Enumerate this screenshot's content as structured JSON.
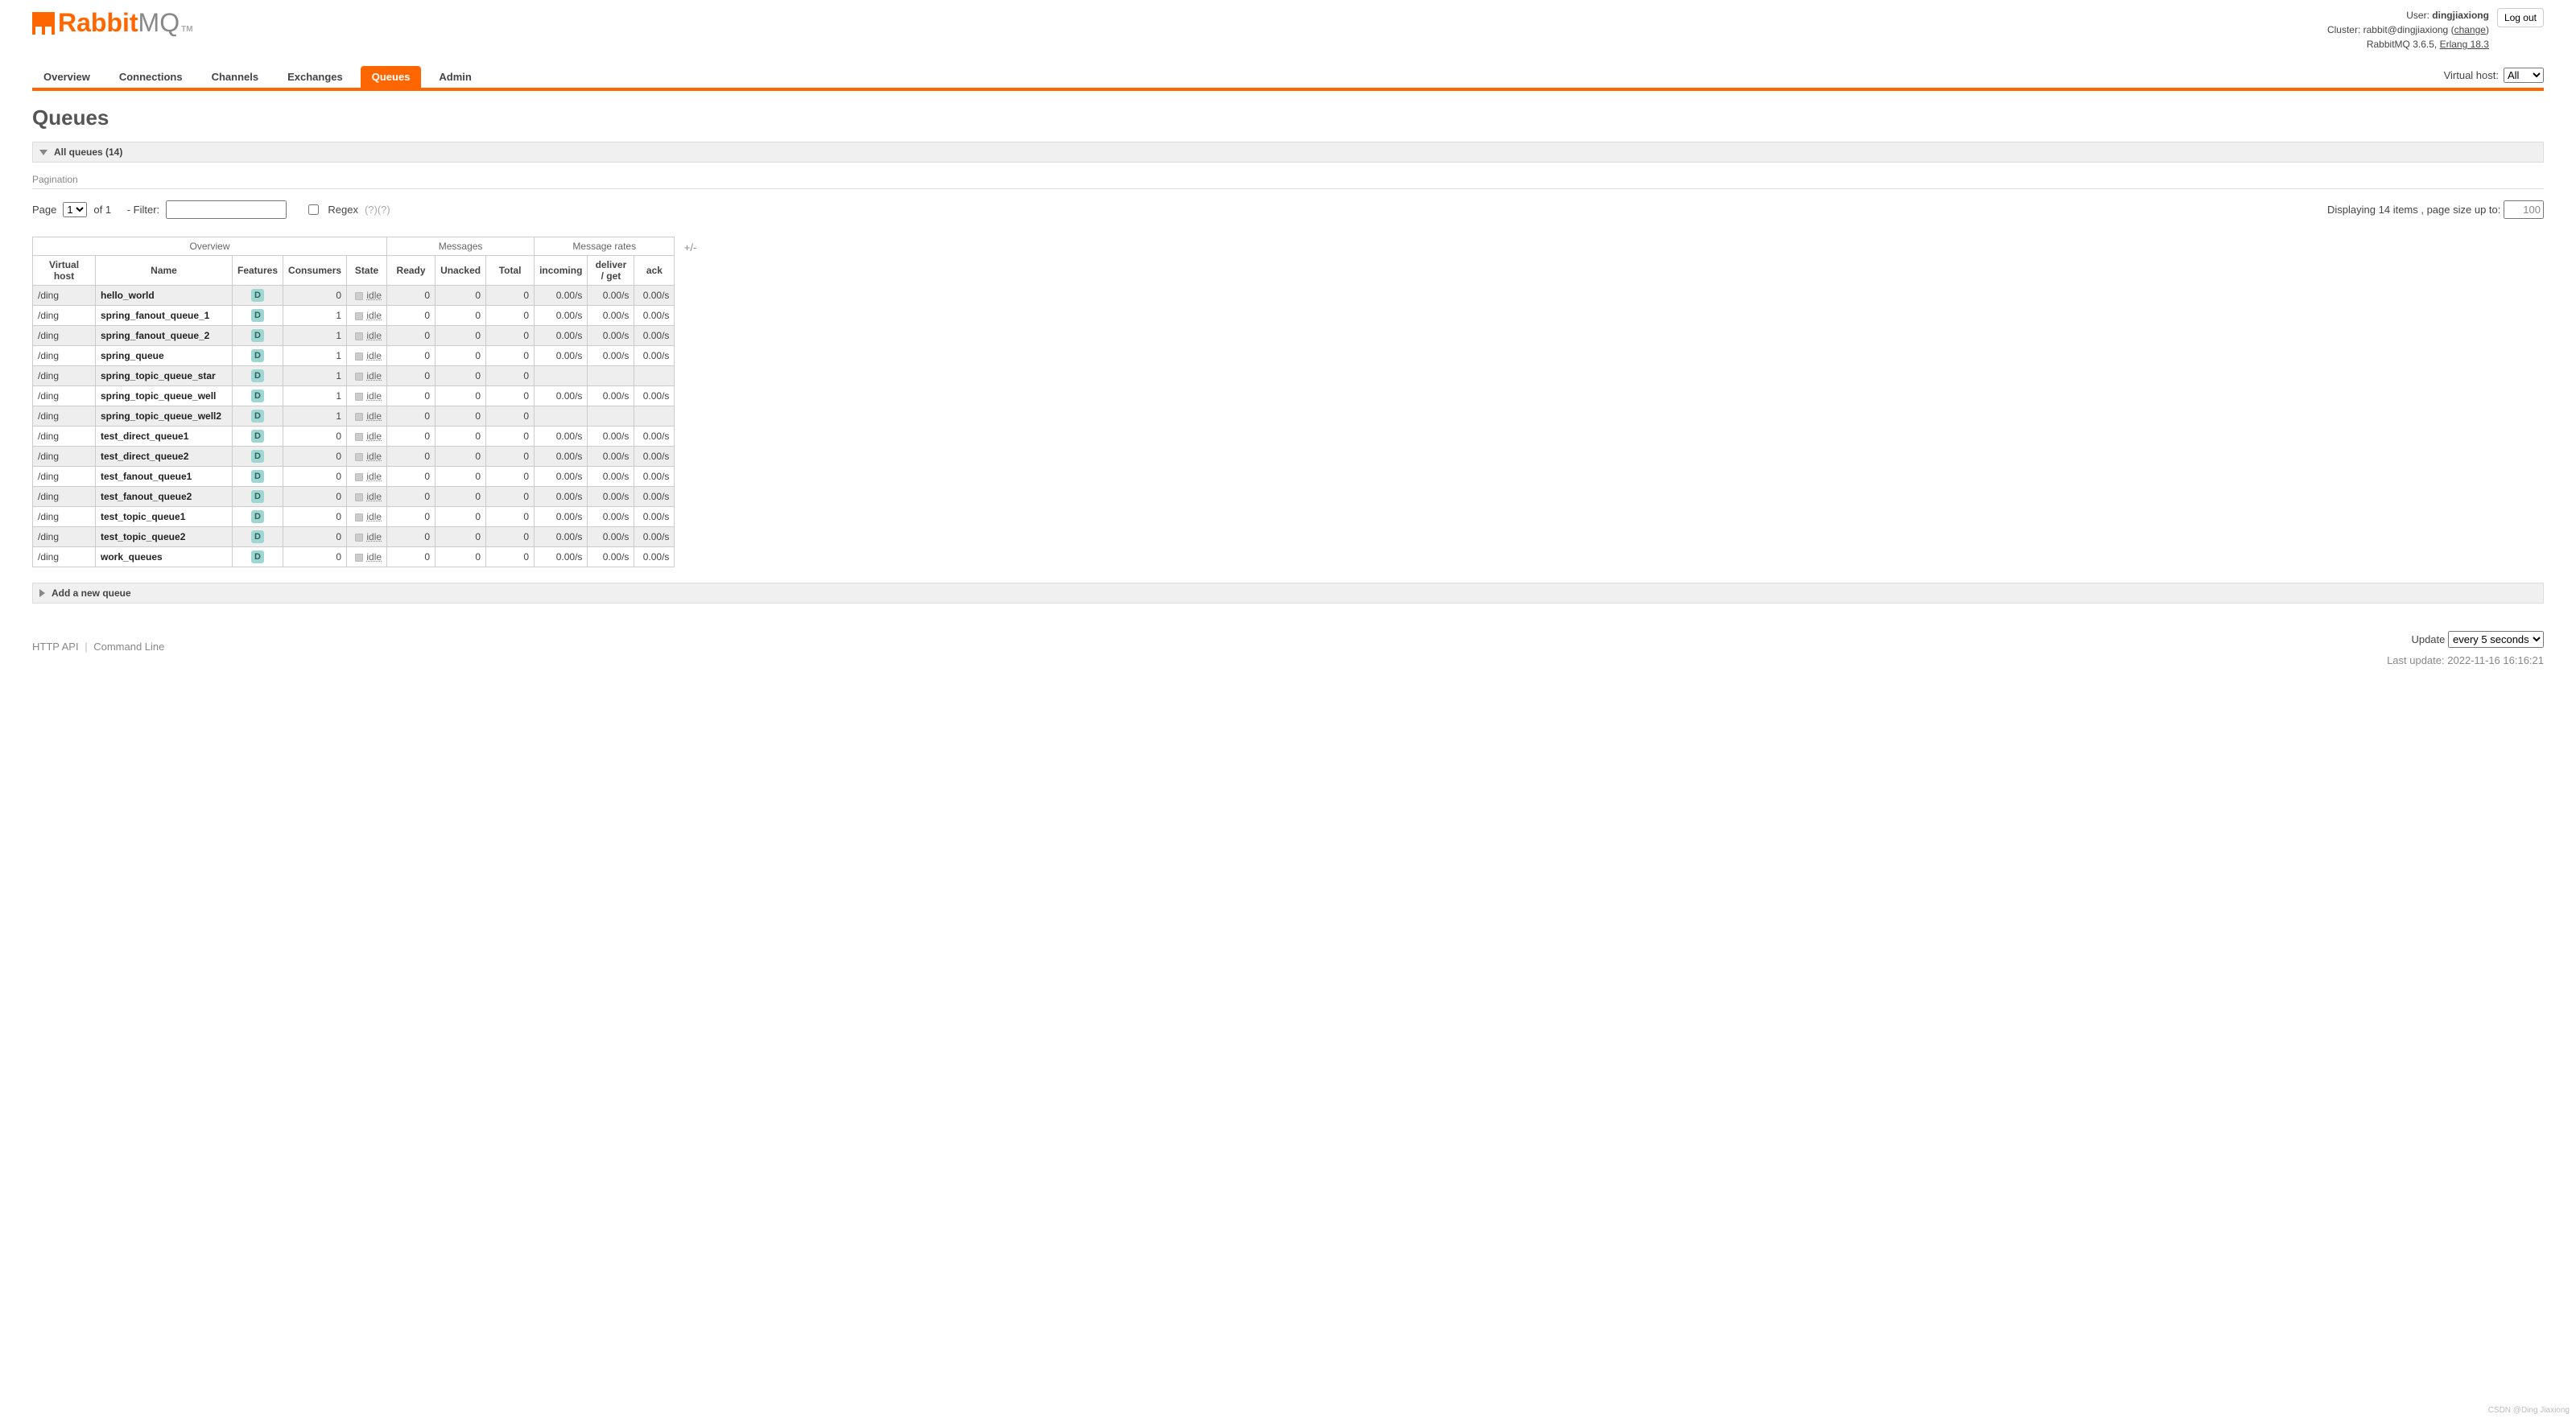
{
  "header": {
    "logo_rabbit": "Rabbit",
    "logo_mq": "MQ",
    "logo_tm": "TM",
    "user_label": "User:",
    "user_name": "dingjiaxiong",
    "cluster_label": "Cluster:",
    "cluster_name": "rabbit@dingjiaxiong",
    "change_link": "change",
    "product": "RabbitMQ 3.6.5,",
    "erlang": "Erlang 18.3",
    "logout": "Log out"
  },
  "nav": {
    "tabs": [
      "Overview",
      "Connections",
      "Channels",
      "Exchanges",
      "Queues",
      "Admin"
    ],
    "active": "Queues",
    "vhost_label": "Virtual host:",
    "vhost_value": "All"
  },
  "title": "Queues",
  "all_queues_header": "All queues (14)",
  "pagination_label": "Pagination",
  "pager": {
    "page_label": "Page",
    "page_value": "1",
    "of_label": "of 1",
    "filter_label": "- Filter:",
    "filter_value": "",
    "regex_label": "Regex",
    "regex_help": "(?)(?)",
    "display_label": "Displaying 14 items , page size up to:",
    "size_value": "100"
  },
  "table": {
    "groups": {
      "overview": "Overview",
      "messages": "Messages",
      "rates": "Message rates"
    },
    "headers": {
      "vhost": "Virtual host",
      "name": "Name",
      "features": "Features",
      "consumers": "Consumers",
      "state": "State",
      "ready": "Ready",
      "unacked": "Unacked",
      "total": "Total",
      "incoming": "incoming",
      "deliver": "deliver / get",
      "ack": "ack"
    },
    "plusminus": "+/-",
    "feature_badge": "D",
    "state_idle": "idle",
    "rows": [
      {
        "vhost": "/ding",
        "name": "hello_world",
        "consumers": "0",
        "ready": "0",
        "unacked": "0",
        "total": "0",
        "incoming": "0.00/s",
        "deliver": "0.00/s",
        "ack": "0.00/s"
      },
      {
        "vhost": "/ding",
        "name": "spring_fanout_queue_1",
        "consumers": "1",
        "ready": "0",
        "unacked": "0",
        "total": "0",
        "incoming": "0.00/s",
        "deliver": "0.00/s",
        "ack": "0.00/s"
      },
      {
        "vhost": "/ding",
        "name": "spring_fanout_queue_2",
        "consumers": "1",
        "ready": "0",
        "unacked": "0",
        "total": "0",
        "incoming": "0.00/s",
        "deliver": "0.00/s",
        "ack": "0.00/s"
      },
      {
        "vhost": "/ding",
        "name": "spring_queue",
        "consumers": "1",
        "ready": "0",
        "unacked": "0",
        "total": "0",
        "incoming": "0.00/s",
        "deliver": "0.00/s",
        "ack": "0.00/s"
      },
      {
        "vhost": "/ding",
        "name": "spring_topic_queue_star",
        "consumers": "1",
        "ready": "0",
        "unacked": "0",
        "total": "0",
        "incoming": "",
        "deliver": "",
        "ack": ""
      },
      {
        "vhost": "/ding",
        "name": "spring_topic_queue_well",
        "consumers": "1",
        "ready": "0",
        "unacked": "0",
        "total": "0",
        "incoming": "0.00/s",
        "deliver": "0.00/s",
        "ack": "0.00/s"
      },
      {
        "vhost": "/ding",
        "name": "spring_topic_queue_well2",
        "consumers": "1",
        "ready": "0",
        "unacked": "0",
        "total": "0",
        "incoming": "",
        "deliver": "",
        "ack": ""
      },
      {
        "vhost": "/ding",
        "name": "test_direct_queue1",
        "consumers": "0",
        "ready": "0",
        "unacked": "0",
        "total": "0",
        "incoming": "0.00/s",
        "deliver": "0.00/s",
        "ack": "0.00/s"
      },
      {
        "vhost": "/ding",
        "name": "test_direct_queue2",
        "consumers": "0",
        "ready": "0",
        "unacked": "0",
        "total": "0",
        "incoming": "0.00/s",
        "deliver": "0.00/s",
        "ack": "0.00/s"
      },
      {
        "vhost": "/ding",
        "name": "test_fanout_queue1",
        "consumers": "0",
        "ready": "0",
        "unacked": "0",
        "total": "0",
        "incoming": "0.00/s",
        "deliver": "0.00/s",
        "ack": "0.00/s"
      },
      {
        "vhost": "/ding",
        "name": "test_fanout_queue2",
        "consumers": "0",
        "ready": "0",
        "unacked": "0",
        "total": "0",
        "incoming": "0.00/s",
        "deliver": "0.00/s",
        "ack": "0.00/s"
      },
      {
        "vhost": "/ding",
        "name": "test_topic_queue1",
        "consumers": "0",
        "ready": "0",
        "unacked": "0",
        "total": "0",
        "incoming": "0.00/s",
        "deliver": "0.00/s",
        "ack": "0.00/s"
      },
      {
        "vhost": "/ding",
        "name": "test_topic_queue2",
        "consumers": "0",
        "ready": "0",
        "unacked": "0",
        "total": "0",
        "incoming": "0.00/s",
        "deliver": "0.00/s",
        "ack": "0.00/s"
      },
      {
        "vhost": "/ding",
        "name": "work_queues",
        "consumers": "0",
        "ready": "0",
        "unacked": "0",
        "total": "0",
        "incoming": "0.00/s",
        "deliver": "0.00/s",
        "ack": "0.00/s"
      }
    ]
  },
  "add_new_queue": "Add a new queue",
  "footer": {
    "http_api": "HTTP API",
    "cli": "Command Line"
  },
  "update": {
    "label": "Update",
    "value": "every 5 seconds",
    "last_label": "Last update:",
    "last_value": "2022-11-16 16:16:21"
  },
  "watermark": "CSDN @Ding Jiaxiong"
}
